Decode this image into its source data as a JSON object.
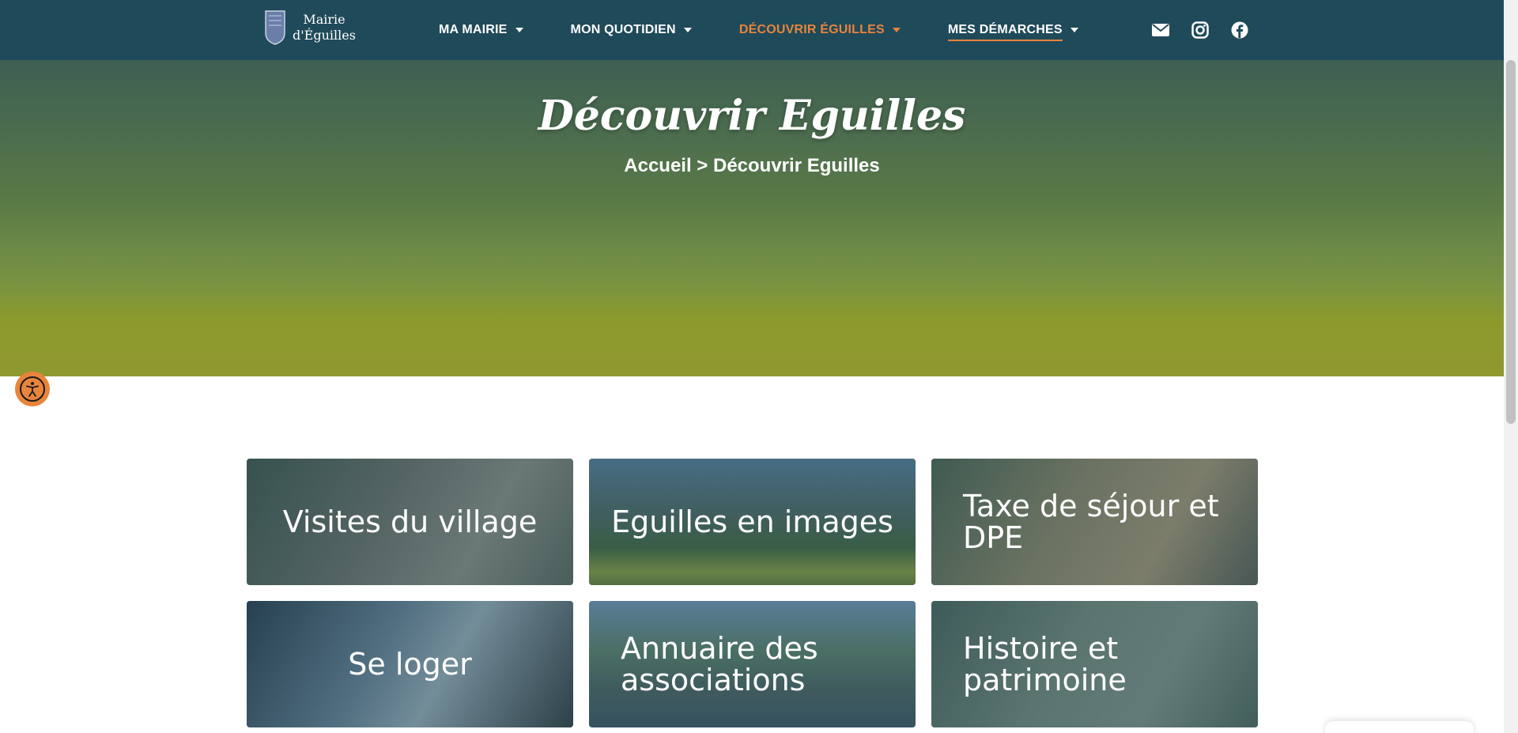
{
  "header": {
    "logo": {
      "line1": "Mairie",
      "line2": "d'Éguilles"
    },
    "nav": [
      {
        "label": "MA MAIRIE"
      },
      {
        "label": "MON QUOTIDIEN"
      },
      {
        "label": "DÉCOUVRIR ÉGUILLES"
      },
      {
        "label": "MES DÉMARCHES"
      }
    ],
    "socials": [
      "mail-icon",
      "instagram-icon",
      "facebook-icon"
    ]
  },
  "hero": {
    "title": "Découvrir Eguilles",
    "breadcrumb": "Accueil > Découvrir Eguilles"
  },
  "tiles": [
    {
      "label": "Visites du village"
    },
    {
      "label": "Eguilles en images"
    },
    {
      "label": "Taxe de séjour et DPE"
    },
    {
      "label": "Se loger"
    },
    {
      "label": "Annuaire des associations"
    },
    {
      "label": "Histoire et patrimoine"
    }
  ],
  "colors": {
    "header": "#1f4a5a",
    "accent": "#e8843c",
    "text": "#ffffff"
  }
}
